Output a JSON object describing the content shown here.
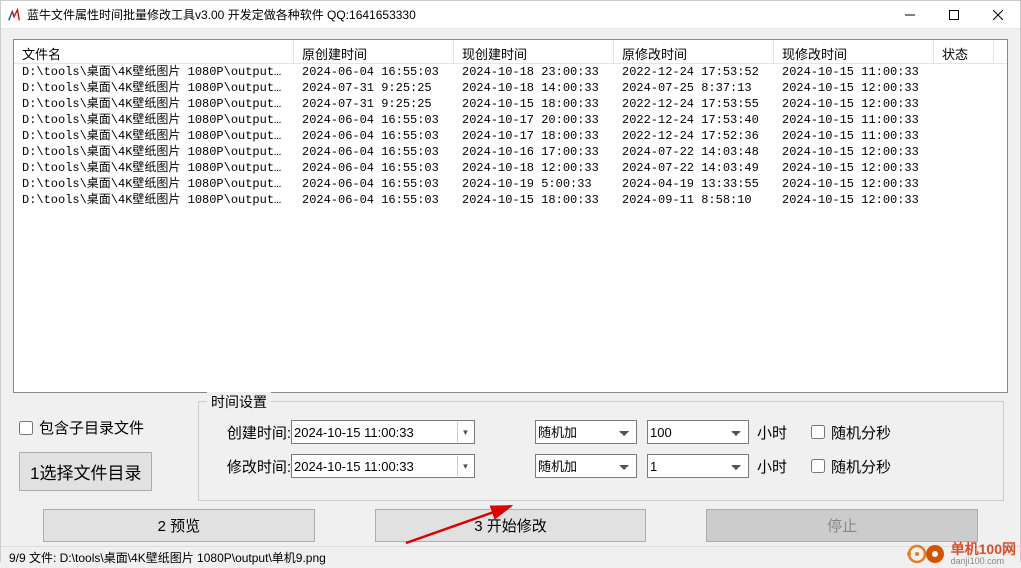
{
  "title": "蓝牛文件属性时间批量修改工具v3.00  开发定做各种软件  QQ:1641653330",
  "columns": {
    "file": "文件名",
    "origCreate": "原创建时间",
    "nowCreate": "现创建时间",
    "origModify": "原修改时间",
    "nowModify": "现修改时间",
    "status": "状态"
  },
  "rows": [
    {
      "file": "D:\\tools\\桌面\\4K壁纸图片 1080P\\output\\单机…",
      "oc": "2024-06-04 16:55:03",
      "nc": "2024-10-18 23:00:33",
      "om": "2022-12-24 17:53:52",
      "nm": "2024-10-15 11:00:33"
    },
    {
      "file": "D:\\tools\\桌面\\4K壁纸图片 1080P\\output\\单机…",
      "oc": "2024-07-31 9:25:25",
      "nc": "2024-10-18 14:00:33",
      "om": "2024-07-25 8:37:13",
      "nm": "2024-10-15 12:00:33"
    },
    {
      "file": "D:\\tools\\桌面\\4K壁纸图片 1080P\\output\\单机…",
      "oc": "2024-07-31 9:25:25",
      "nc": "2024-10-15 18:00:33",
      "om": "2022-12-24 17:53:55",
      "nm": "2024-10-15 12:00:33"
    },
    {
      "file": "D:\\tools\\桌面\\4K壁纸图片 1080P\\output\\单机…",
      "oc": "2024-06-04 16:55:03",
      "nc": "2024-10-17 20:00:33",
      "om": "2022-12-24 17:53:40",
      "nm": "2024-10-15 11:00:33"
    },
    {
      "file": "D:\\tools\\桌面\\4K壁纸图片 1080P\\output\\单机…",
      "oc": "2024-06-04 16:55:03",
      "nc": "2024-10-17 18:00:33",
      "om": "2022-12-24 17:52:36",
      "nm": "2024-10-15 11:00:33"
    },
    {
      "file": "D:\\tools\\桌面\\4K壁纸图片 1080P\\output\\单机…",
      "oc": "2024-06-04 16:55:03",
      "nc": "2024-10-16 17:00:33",
      "om": "2024-07-22 14:03:48",
      "nm": "2024-10-15 12:00:33"
    },
    {
      "file": "D:\\tools\\桌面\\4K壁纸图片 1080P\\output\\单机…",
      "oc": "2024-06-04 16:55:03",
      "nc": "2024-10-18 12:00:33",
      "om": "2024-07-22 14:03:49",
      "nm": "2024-10-15 12:00:33"
    },
    {
      "file": "D:\\tools\\桌面\\4K壁纸图片 1080P\\output\\单机…",
      "oc": "2024-06-04 16:55:03",
      "nc": "2024-10-19 5:00:33",
      "om": "2024-04-19 13:33:55",
      "nm": "2024-10-15 12:00:33"
    },
    {
      "file": "D:\\tools\\桌面\\4K壁纸图片 1080P\\output\\单机…",
      "oc": "2024-06-04 16:55:03",
      "nc": "2024-10-15 18:00:33",
      "om": "2024-09-11 8:58:10",
      "nm": "2024-10-15 12:00:33"
    }
  ],
  "left": {
    "includeSubdir": "包含子目录文件",
    "selectDir": "1选择文件目录"
  },
  "settings": {
    "groupLabel": "时间设置",
    "createLabel": "创建时间:",
    "modifyLabel": "修改时间:",
    "createValue": "2024-10-15 11:00:33",
    "modifyValue": "2024-10-15 11:00:33",
    "randomAdd": "随机加",
    "hours": "小时",
    "randomSec": "随机分秒",
    "num1": "100",
    "num2": "1"
  },
  "buttons": {
    "preview": "2 预览",
    "start": "3 开始修改",
    "stop": "停止"
  },
  "status": "9/9 文件:  D:\\tools\\桌面\\4K壁纸图片 1080P\\output\\单机9.png",
  "watermark": {
    "name": "单机100网",
    "domain": "danji100.com"
  }
}
